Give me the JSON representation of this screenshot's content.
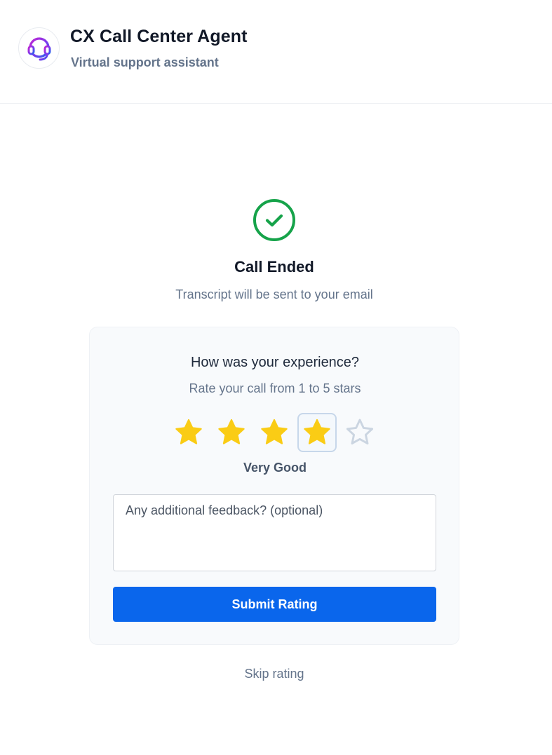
{
  "header": {
    "title": "CX Call Center Agent",
    "subtitle": "Virtual support assistant",
    "logo_icon": "headset-icon",
    "logo_gradient": [
      "#c026d3",
      "#7c3aed",
      "#2563eb"
    ]
  },
  "status": {
    "icon": "check-circle-icon",
    "icon_color": "#16a34a",
    "title": "Call Ended",
    "subtitle": "Transcript will be sent to your email"
  },
  "rating": {
    "title": "How was your experience?",
    "subtitle": "Rate your call from 1 to 5 stars",
    "max_stars": 5,
    "selected": 4,
    "selected_label": "Very Good",
    "filled_color": "#facc15",
    "empty_color": "#cbd5e1"
  },
  "feedback": {
    "placeholder": "Any additional feedback? (optional)",
    "value": ""
  },
  "actions": {
    "submit_label": "Submit Rating",
    "submit_color": "#0a66ec",
    "skip_label": "Skip rating"
  }
}
